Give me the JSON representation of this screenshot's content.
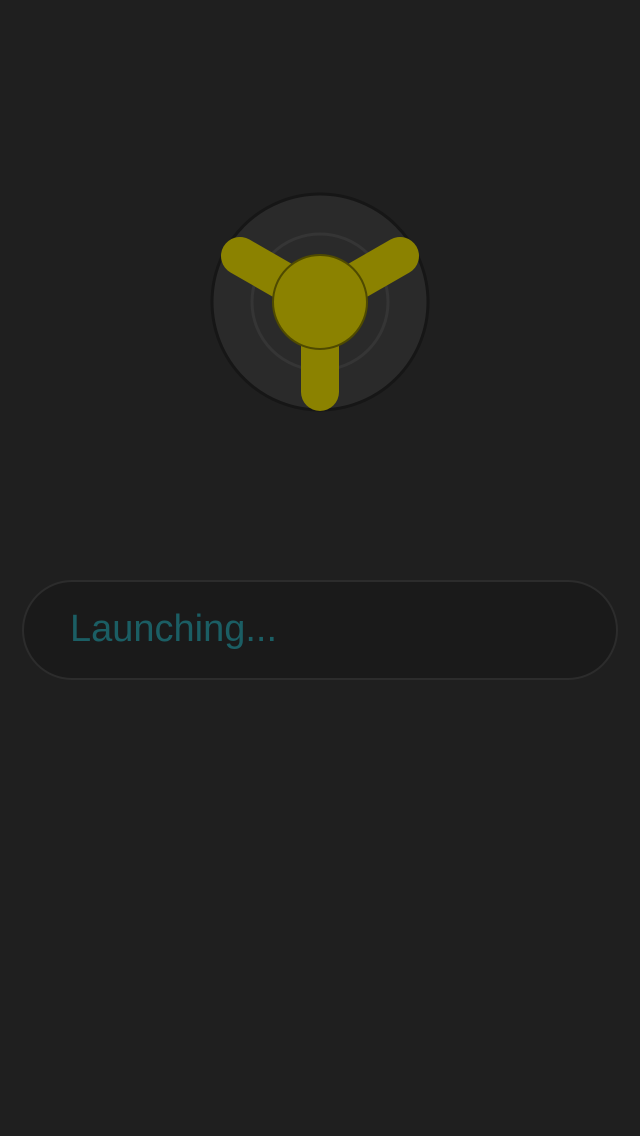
{
  "app": {
    "logo_icon": "tri-blade-rotor-icon",
    "accent_color": "#8b8200",
    "background_color": "#1f1f1f"
  },
  "status": {
    "text": "Launching...",
    "text_color": "#1b5e64"
  }
}
